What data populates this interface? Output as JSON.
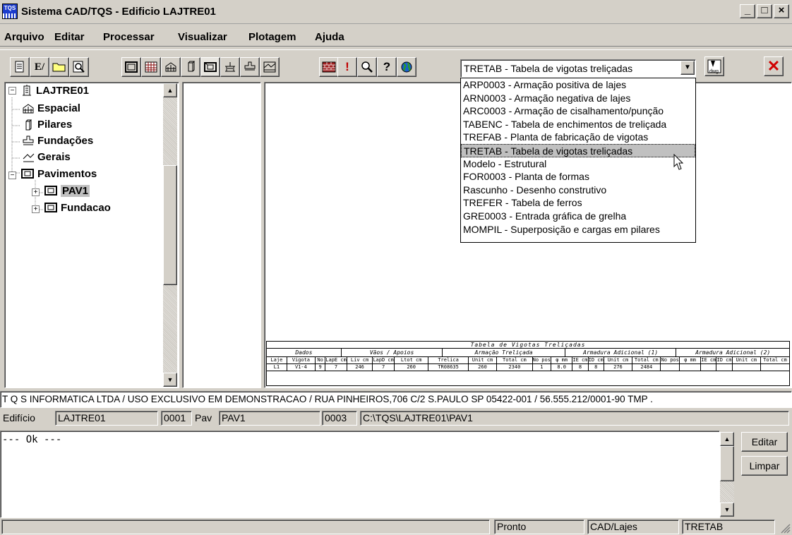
{
  "window": {
    "app_icon_text": "TQS",
    "title": "Sistema CAD/TQS - Edificio LAJTRE01",
    "minimize": "_",
    "maximize": "□",
    "close": "×"
  },
  "menu": [
    "Arquivo",
    "Editar",
    "Processar",
    "Visualizar",
    "Plotagem",
    "Ajuda"
  ],
  "toolbar": {
    "combo_value": "TRETAB - Tabela de vigotas treliçadas",
    "dropdown_options": [
      "ARP0003 - Armação positiva de lajes",
      "ARN0003 - Armação negativa de lajes",
      "ARC0003 - Armação de cisalhamento/punção",
      "TABENC - Tabela de enchimentos de treliçada",
      "TREFAB - Planta de fabricação de vigotas",
      "TRETAB - Tabela de vigotas treliçadas",
      "Modelo - Estrutural",
      "FOR0003 - Planta de formas",
      "Rascunho - Desenho construtivo",
      "TREFER - Tabela de ferros",
      "GRE0003 - Entrada gráfica de grelha",
      "MOMPIL - Superposição e cargas em pilares"
    ],
    "selected_index": 5,
    "dwg_label": "dwg",
    "button_glyphs": {
      "edit_file": "E/",
      "help": "?",
      "alert": "!",
      "zoom": "Q",
      "close_x": "✕"
    }
  },
  "tree": {
    "root": "LAJTRE01",
    "items": [
      {
        "label": "Espacial",
        "icon": "building-3d-icon"
      },
      {
        "label": "Pilares",
        "icon": "column-icon"
      },
      {
        "label": "Fundações",
        "icon": "foundation-icon"
      },
      {
        "label": "Gerais",
        "icon": "general-icon"
      },
      {
        "label": "Pavimentos",
        "icon": "floor-icon"
      }
    ],
    "children": [
      {
        "label": "PAV1",
        "icon": "floor-icon"
      },
      {
        "label": "Fundacao",
        "icon": "floor-icon"
      }
    ],
    "expander_minus": "−",
    "expander_plus": "+"
  },
  "table": {
    "title": "Tabela de Vigotas Treliçadas",
    "groups": [
      "Dados",
      "Vãos / Apoios",
      "Armação Treliçada",
      "Armadura Adicional (1)",
      "Armadura Adicional (2)"
    ],
    "headers": [
      "Laje",
      "Vigota",
      "No",
      "LapE cm",
      "Liv cm",
      "LapD cm",
      "Ltot cm",
      "Trelica",
      "Unit cm",
      "Total cm",
      "No pos",
      "φ mm",
      "IE cm",
      "ID cm",
      "Unit cm",
      "Total cm",
      "No pos",
      "φ mm",
      "IE cm",
      "ID cm",
      "Unit cm",
      "Total cm"
    ],
    "row": [
      "L1",
      "V1-4",
      "9",
      "7",
      "246",
      "7",
      "260",
      "TR08635",
      "260",
      "2340",
      "1",
      "8.0",
      "8",
      "8",
      "276",
      "2484",
      "",
      "",
      "",
      "",
      "",
      ""
    ]
  },
  "copyright": "T Q S  INFORMATICA LTDA / USO EXCLUSIVO EM DEMONSTRACAO / RUA PINHEIROS,706 C/2 S.PAULO SP 05422-001 / 56.555.212/0001-90 TMP .",
  "info": {
    "edificio_label": "Edifício",
    "edificio_value": "LAJTRE01",
    "edificio_code": "0001",
    "pav_label": "Pav",
    "pav_value": "PAV1",
    "pav_code": "0003",
    "path": "C:\\TQS\\LAJTRE01\\PAV1"
  },
  "console": {
    "text": "--- Ok ---",
    "editar": "Editar",
    "limpar": "Limpar"
  },
  "status": [
    "Pronto",
    "CAD/Lajes",
    "TRETAB"
  ]
}
